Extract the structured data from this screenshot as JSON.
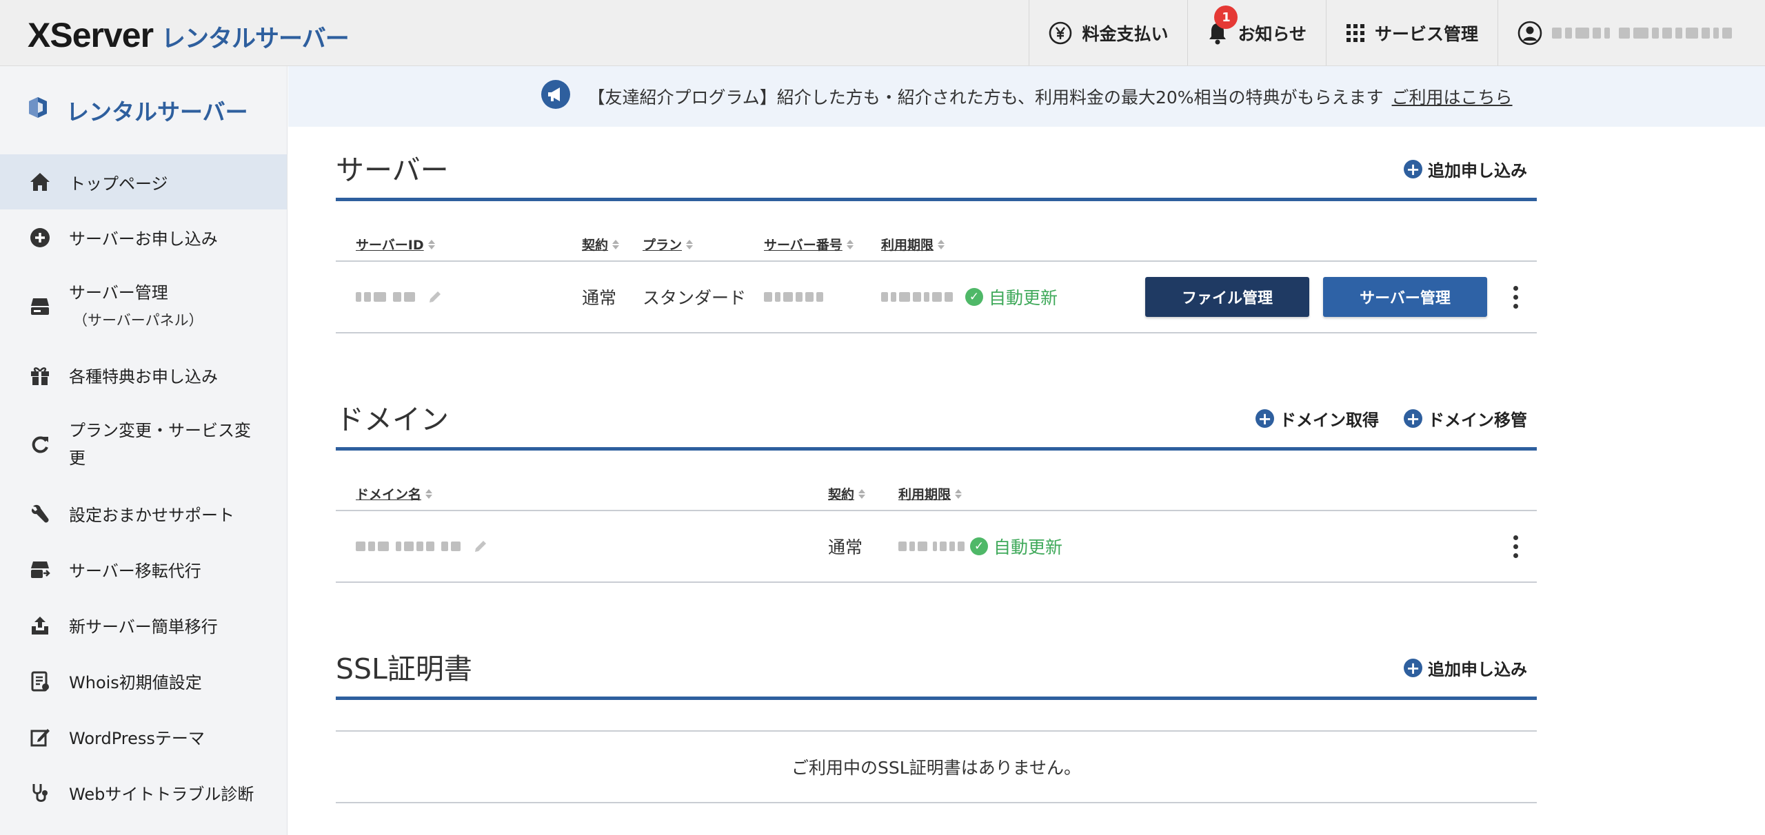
{
  "brand": {
    "name": "XServer",
    "sub": "レンタルサーバー",
    "accent": "#2e5f9e"
  },
  "header_nav": [
    {
      "label": "料金支払い",
      "icon": "yen-icon"
    },
    {
      "label": "お知らせ",
      "icon": "bell-icon",
      "badge": "1"
    },
    {
      "label": "サービス管理",
      "icon": "grid-icon"
    }
  ],
  "user": {
    "icon": "user-circle-icon"
  },
  "sidebar": {
    "title": "レンタルサーバー",
    "items": [
      {
        "label": "トップページ",
        "icon": "home-icon",
        "active": true
      },
      {
        "label": "サーバーお申し込み",
        "icon": "plus-circle-icon"
      },
      {
        "label": "サーバー管理",
        "sub": "（サーバーパネル）",
        "icon": "server-icon"
      },
      {
        "label": "各種特典お申し込み",
        "icon": "gift-icon"
      },
      {
        "label": "プラン変更・サービス変",
        "label2": "更",
        "icon": "refresh-icon"
      },
      {
        "label": "設定おまかせサポート",
        "icon": "wrench-icon"
      },
      {
        "label": "サーバー移転代行",
        "icon": "server-transfer-icon"
      },
      {
        "label": "新サーバー簡単移行",
        "icon": "upload-icon"
      },
      {
        "label": "Whois初期値設定",
        "icon": "document-icon"
      },
      {
        "label": "WordPressテーマ",
        "icon": "edit-square-icon"
      },
      {
        "label": "Webサイトトラブル診断",
        "icon": "stethoscope-icon"
      }
    ]
  },
  "banner": {
    "text": "【友達紹介プログラム】紹介した方も・紹介された方も、利用料金の最大20%相当の特典がもらえます",
    "link": "ご利用はこちら"
  },
  "server_section": {
    "title": "サーバー",
    "add_label": "追加申し込み",
    "columns": [
      "サーバーID",
      "契約",
      "プラン",
      "サーバー番号",
      "利用期限"
    ],
    "row": {
      "contract": "通常",
      "plan": "スタンダード",
      "status": "自動更新",
      "file_button": "ファイル管理",
      "server_button": "サーバー管理"
    }
  },
  "domain_section": {
    "title": "ドメイン",
    "acquire_label": "ドメイン取得",
    "transfer_label": "ドメイン移管",
    "columns": [
      "ドメイン名",
      "契約",
      "利用期限"
    ],
    "row": {
      "contract": "通常",
      "status": "自動更新"
    }
  },
  "ssl_section": {
    "title": "SSL証明書",
    "add_label": "追加申し込み",
    "empty_text": "ご利用中のSSL証明書はありません。"
  }
}
